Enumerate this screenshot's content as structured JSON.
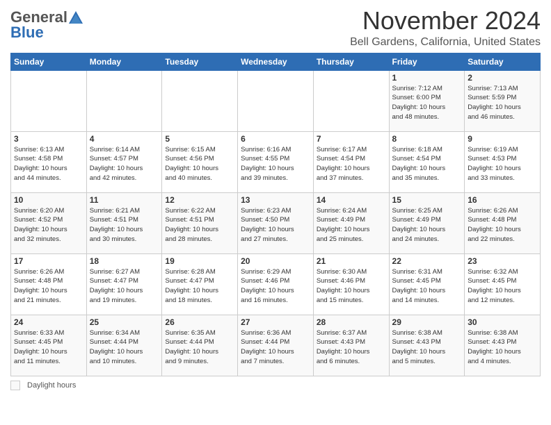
{
  "header": {
    "logo_general": "General",
    "logo_blue": "Blue",
    "month_title": "November 2024",
    "location": "Bell Gardens, California, United States"
  },
  "weekdays": [
    "Sunday",
    "Monday",
    "Tuesday",
    "Wednesday",
    "Thursday",
    "Friday",
    "Saturday"
  ],
  "footer_label": "Daylight hours",
  "weeks": [
    [
      {
        "day": "",
        "info": ""
      },
      {
        "day": "",
        "info": ""
      },
      {
        "day": "",
        "info": ""
      },
      {
        "day": "",
        "info": ""
      },
      {
        "day": "",
        "info": ""
      },
      {
        "day": "1",
        "info": "Sunrise: 7:12 AM\nSunset: 6:00 PM\nDaylight: 10 hours\nand 48 minutes."
      },
      {
        "day": "2",
        "info": "Sunrise: 7:13 AM\nSunset: 5:59 PM\nDaylight: 10 hours\nand 46 minutes."
      }
    ],
    [
      {
        "day": "3",
        "info": "Sunrise: 6:13 AM\nSunset: 4:58 PM\nDaylight: 10 hours\nand 44 minutes."
      },
      {
        "day": "4",
        "info": "Sunrise: 6:14 AM\nSunset: 4:57 PM\nDaylight: 10 hours\nand 42 minutes."
      },
      {
        "day": "5",
        "info": "Sunrise: 6:15 AM\nSunset: 4:56 PM\nDaylight: 10 hours\nand 40 minutes."
      },
      {
        "day": "6",
        "info": "Sunrise: 6:16 AM\nSunset: 4:55 PM\nDaylight: 10 hours\nand 39 minutes."
      },
      {
        "day": "7",
        "info": "Sunrise: 6:17 AM\nSunset: 4:54 PM\nDaylight: 10 hours\nand 37 minutes."
      },
      {
        "day": "8",
        "info": "Sunrise: 6:18 AM\nSunset: 4:54 PM\nDaylight: 10 hours\nand 35 minutes."
      },
      {
        "day": "9",
        "info": "Sunrise: 6:19 AM\nSunset: 4:53 PM\nDaylight: 10 hours\nand 33 minutes."
      }
    ],
    [
      {
        "day": "10",
        "info": "Sunrise: 6:20 AM\nSunset: 4:52 PM\nDaylight: 10 hours\nand 32 minutes."
      },
      {
        "day": "11",
        "info": "Sunrise: 6:21 AM\nSunset: 4:51 PM\nDaylight: 10 hours\nand 30 minutes."
      },
      {
        "day": "12",
        "info": "Sunrise: 6:22 AM\nSunset: 4:51 PM\nDaylight: 10 hours\nand 28 minutes."
      },
      {
        "day": "13",
        "info": "Sunrise: 6:23 AM\nSunset: 4:50 PM\nDaylight: 10 hours\nand 27 minutes."
      },
      {
        "day": "14",
        "info": "Sunrise: 6:24 AM\nSunset: 4:49 PM\nDaylight: 10 hours\nand 25 minutes."
      },
      {
        "day": "15",
        "info": "Sunrise: 6:25 AM\nSunset: 4:49 PM\nDaylight: 10 hours\nand 24 minutes."
      },
      {
        "day": "16",
        "info": "Sunrise: 6:26 AM\nSunset: 4:48 PM\nDaylight: 10 hours\nand 22 minutes."
      }
    ],
    [
      {
        "day": "17",
        "info": "Sunrise: 6:26 AM\nSunset: 4:48 PM\nDaylight: 10 hours\nand 21 minutes."
      },
      {
        "day": "18",
        "info": "Sunrise: 6:27 AM\nSunset: 4:47 PM\nDaylight: 10 hours\nand 19 minutes."
      },
      {
        "day": "19",
        "info": "Sunrise: 6:28 AM\nSunset: 4:47 PM\nDaylight: 10 hours\nand 18 minutes."
      },
      {
        "day": "20",
        "info": "Sunrise: 6:29 AM\nSunset: 4:46 PM\nDaylight: 10 hours\nand 16 minutes."
      },
      {
        "day": "21",
        "info": "Sunrise: 6:30 AM\nSunset: 4:46 PM\nDaylight: 10 hours\nand 15 minutes."
      },
      {
        "day": "22",
        "info": "Sunrise: 6:31 AM\nSunset: 4:45 PM\nDaylight: 10 hours\nand 14 minutes."
      },
      {
        "day": "23",
        "info": "Sunrise: 6:32 AM\nSunset: 4:45 PM\nDaylight: 10 hours\nand 12 minutes."
      }
    ],
    [
      {
        "day": "24",
        "info": "Sunrise: 6:33 AM\nSunset: 4:45 PM\nDaylight: 10 hours\nand 11 minutes."
      },
      {
        "day": "25",
        "info": "Sunrise: 6:34 AM\nSunset: 4:44 PM\nDaylight: 10 hours\nand 10 minutes."
      },
      {
        "day": "26",
        "info": "Sunrise: 6:35 AM\nSunset: 4:44 PM\nDaylight: 10 hours\nand 9 minutes."
      },
      {
        "day": "27",
        "info": "Sunrise: 6:36 AM\nSunset: 4:44 PM\nDaylight: 10 hours\nand 7 minutes."
      },
      {
        "day": "28",
        "info": "Sunrise: 6:37 AM\nSunset: 4:43 PM\nDaylight: 10 hours\nand 6 minutes."
      },
      {
        "day": "29",
        "info": "Sunrise: 6:38 AM\nSunset: 4:43 PM\nDaylight: 10 hours\nand 5 minutes."
      },
      {
        "day": "30",
        "info": "Sunrise: 6:38 AM\nSunset: 4:43 PM\nDaylight: 10 hours\nand 4 minutes."
      }
    ]
  ]
}
